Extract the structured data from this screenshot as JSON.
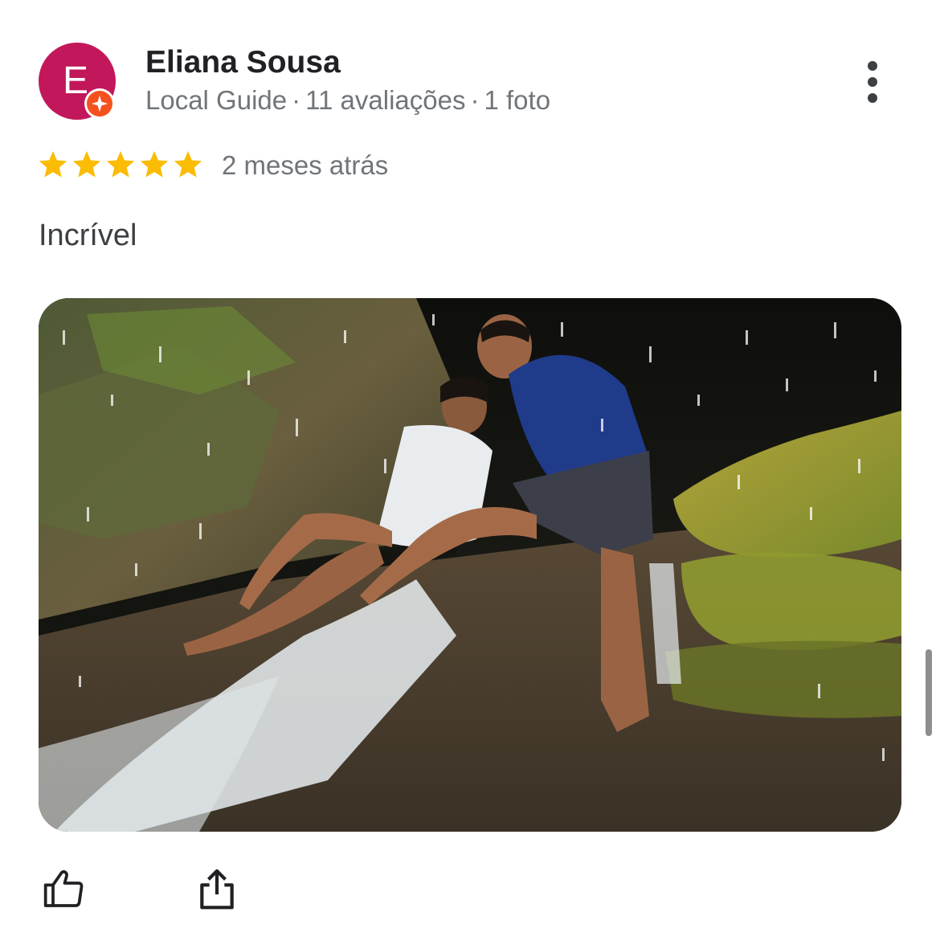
{
  "reviewer": {
    "initial": "E",
    "name": "Eliana Sousa",
    "badge": "Local Guide",
    "review_count": "11 avaliações",
    "photo_count": "1 foto",
    "separator": "·",
    "avatar_color": "#c2185b",
    "badge_color": "#f4511e"
  },
  "review": {
    "rating": 5,
    "rating_max": 5,
    "star_color": "#fbbc04",
    "date": "2 meses atrás",
    "text": "Incrível",
    "photo_alt": "Couple sitting on rocks under a waterfall"
  },
  "actions": {
    "like_icon": "thumb-up-icon",
    "share_icon": "share-icon",
    "more_icon": "more-vert-icon"
  }
}
